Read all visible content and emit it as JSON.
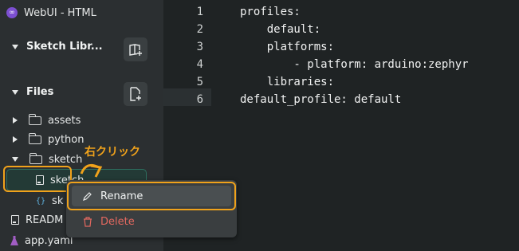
{
  "app": {
    "title": "WebUI - HTML"
  },
  "sections": {
    "sketch_library": {
      "label": "Sketch Libr..."
    },
    "files": {
      "label": "Files"
    }
  },
  "tree": {
    "assets": "assets",
    "python": "python",
    "sketch": "sketch",
    "sketch_file": "sketch",
    "sketch_json": "sk",
    "readme": "READM",
    "app_yaml": "app.yaml"
  },
  "annotation": {
    "right_click": "右クリック"
  },
  "context_menu": {
    "rename": "Rename",
    "delete": "Delete"
  },
  "editor": {
    "line_numbers": [
      "1",
      "2",
      "3",
      "4",
      "5",
      "6"
    ],
    "lines": [
      "profiles:",
      "    default:",
      "    platforms:",
      "        - platform: arduino:zephyr",
      "    libraries:",
      "default_profile: default"
    ]
  },
  "colors": {
    "accent_orange": "#f0a21b",
    "delete_red": "#e2685f",
    "selection_green": "#2d6f5f"
  }
}
